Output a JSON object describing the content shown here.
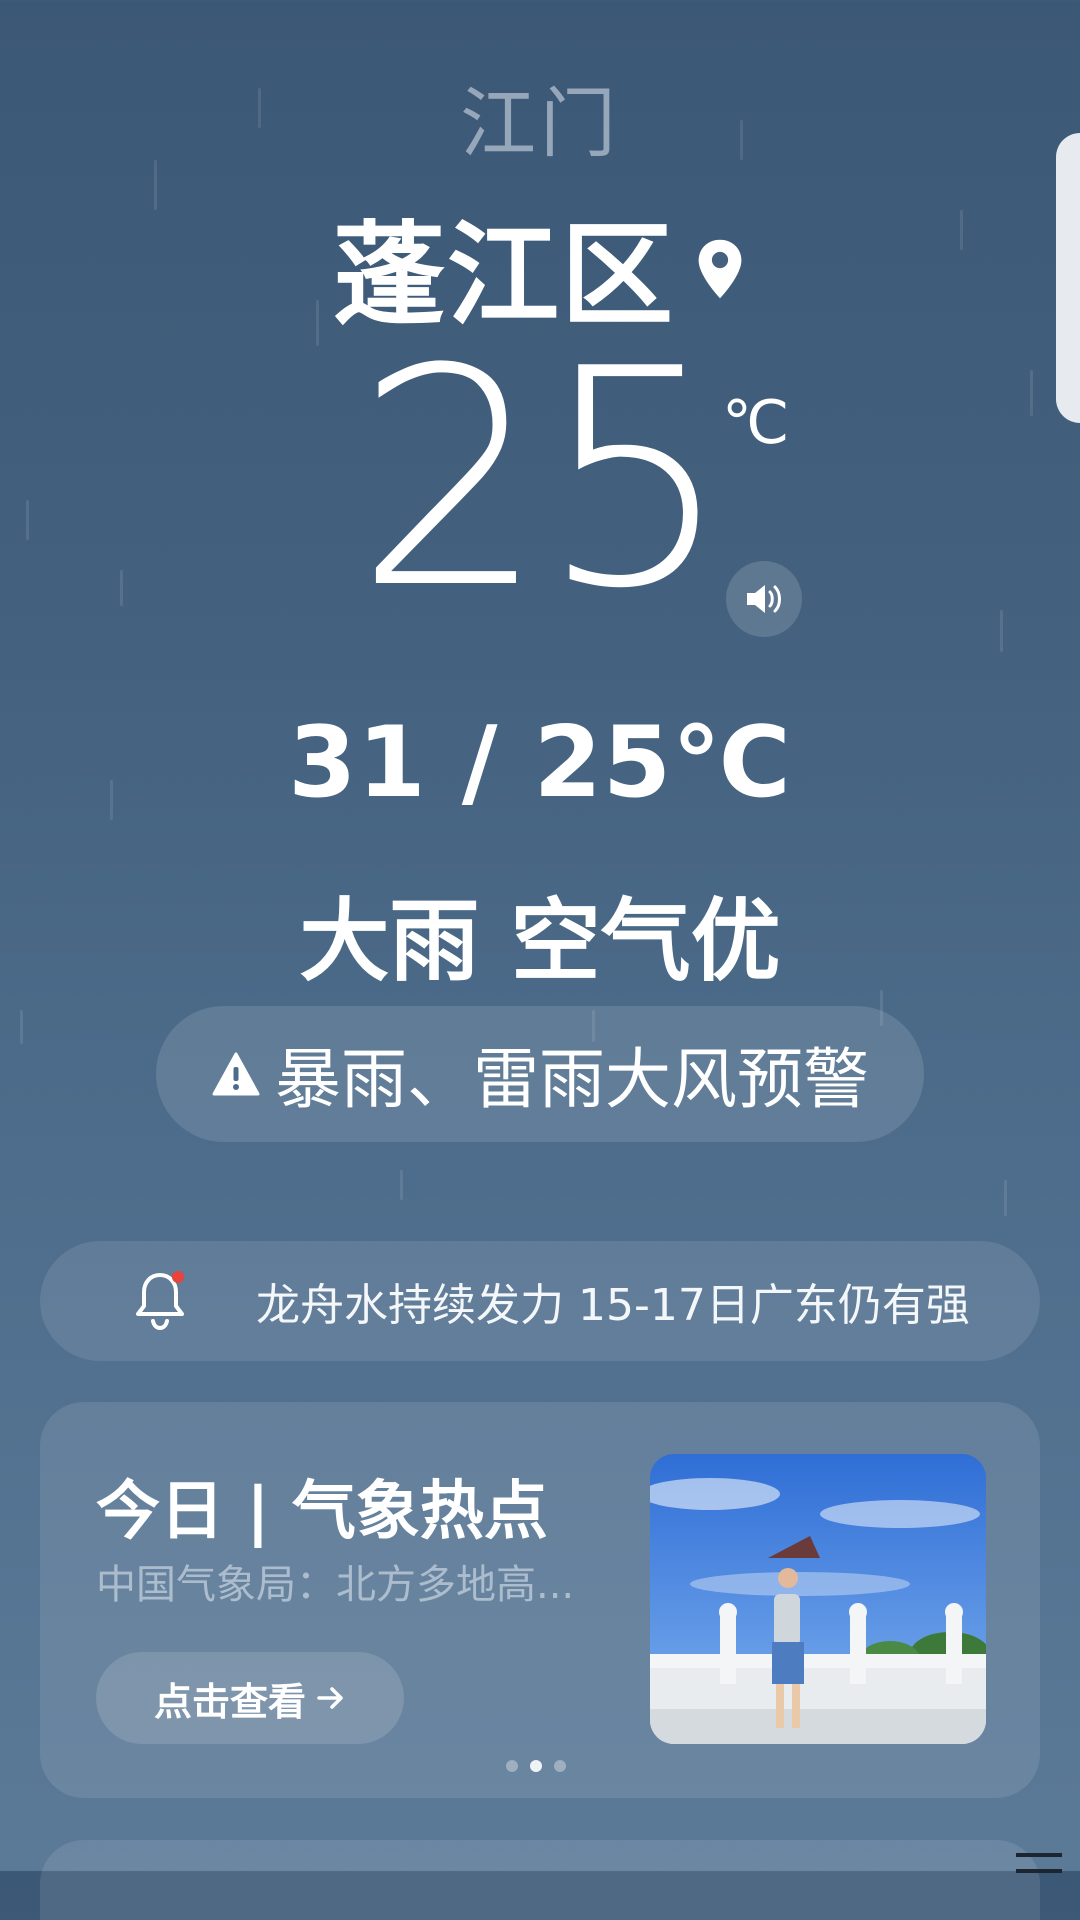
{
  "location": {
    "city": "江门",
    "district": "蓬江区"
  },
  "current": {
    "temperature": "25",
    "unit": "℃"
  },
  "today": {
    "range": "31 / 25℃",
    "condition": "大雨 空气优"
  },
  "alert": {
    "text": "暴雨、雷雨大风预警"
  },
  "news_ticker": {
    "text": "龙舟水持续发力 15-17日广东仍有强"
  },
  "hot_card": {
    "title": "今日 | 气象热点",
    "subtitle": "中国气象局：北方多地高...",
    "button_label": "点击查看",
    "carousel_total": 3,
    "carousel_active": 2
  },
  "icons": {
    "pin": "location-pin-icon",
    "speaker": "speaker-icon",
    "alert": "warning-icon",
    "bell": "bell-icon",
    "arrow": "arrow-right-icon"
  },
  "colors": {
    "notification_dot": "#e8433c"
  }
}
